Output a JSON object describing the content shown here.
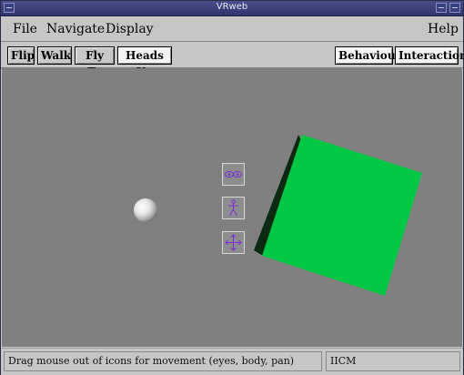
{
  "window": {
    "title": "VRweb"
  },
  "menubar": {
    "file": "File",
    "navigate": "Navigate",
    "display": "Display",
    "help": "Help"
  },
  "toolbar": {
    "flip": "Flip",
    "walk": "Walk",
    "fly_to": "Fly To",
    "heads_up": "Heads Up",
    "behaviour": "Behaviour",
    "interaction": "Interaction"
  },
  "viewport": {
    "background": "#808080",
    "cube_color": "#00c845",
    "icon_color": "#7a2bd8",
    "icons": [
      "eyes-icon",
      "body-icon",
      "pan-icon"
    ]
  },
  "status": {
    "message": "Drag mouse out of icons for movement (eyes, body, pan)",
    "right": "IICM"
  }
}
